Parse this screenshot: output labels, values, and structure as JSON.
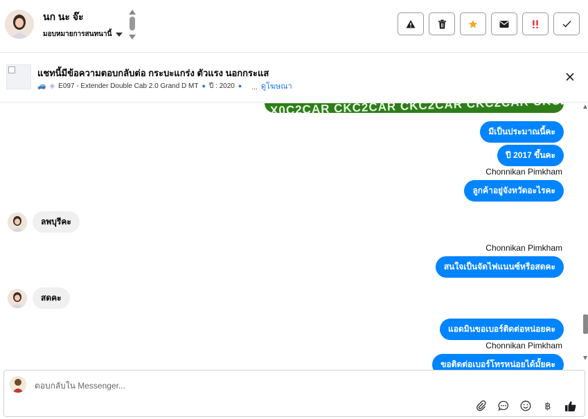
{
  "header": {
    "name": "นก นะ จ๊ะ",
    "assign_label": "มอบหมายการสนทนานี้",
    "actions": [
      {
        "name": "report-button",
        "icon": "warning-icon"
      },
      {
        "name": "delete-button",
        "icon": "trash-icon"
      },
      {
        "name": "star-button",
        "icon": "star-icon"
      },
      {
        "name": "mark-unread-button",
        "icon": "envelope-icon"
      },
      {
        "name": "spam-button",
        "icon": "exclamation-icon"
      },
      {
        "name": "done-button",
        "icon": "check-icon"
      }
    ],
    "colors": {
      "star": "#f5a623",
      "spam": "#e4292f"
    }
  },
  "listing": {
    "title": "แชทนี้มีข้อความตอบกลับต่อ กระบะแกร่ง ตัวแรง นอกกระแส",
    "model": "E097 - Extender Double Cab 2.0 Grand D MT",
    "year": "ปี : 2020",
    "more": "ᅟ...",
    "view_ad": "ดูโฆษณา"
  },
  "ad_image_text": "X0C2CAR CKC2CAR CKC2CAR CKC2CAR CKC2",
  "messages": {
    "m1": "มีเป็นประมาณนี้คะ",
    "m2": "ปี 2017 ขึ้นคะ",
    "s1": "Chonnikan Pimkham",
    "m3": "ลูกค้าอยู่จังหวัดอะไรคะ",
    "in1": "ลพบุรีคะ",
    "s2": "Chonnikan Pimkham",
    "m4": "สนใจเป็นจัดไฟแนนซ์หรือสดคะ",
    "in2": "สดคะ",
    "m5": "แอดมินขอเบอร์ติดต่อหน่อยคะ",
    "s3": "Chonnikan Pimkham",
    "m6": "ขอติดต่อเบอร์โทรหน่อยได้มั้ยคะ"
  },
  "composer": {
    "placeholder": "ตอบกลับใน Messenger...",
    "currency": "฿"
  },
  "accent": "#0084ff"
}
